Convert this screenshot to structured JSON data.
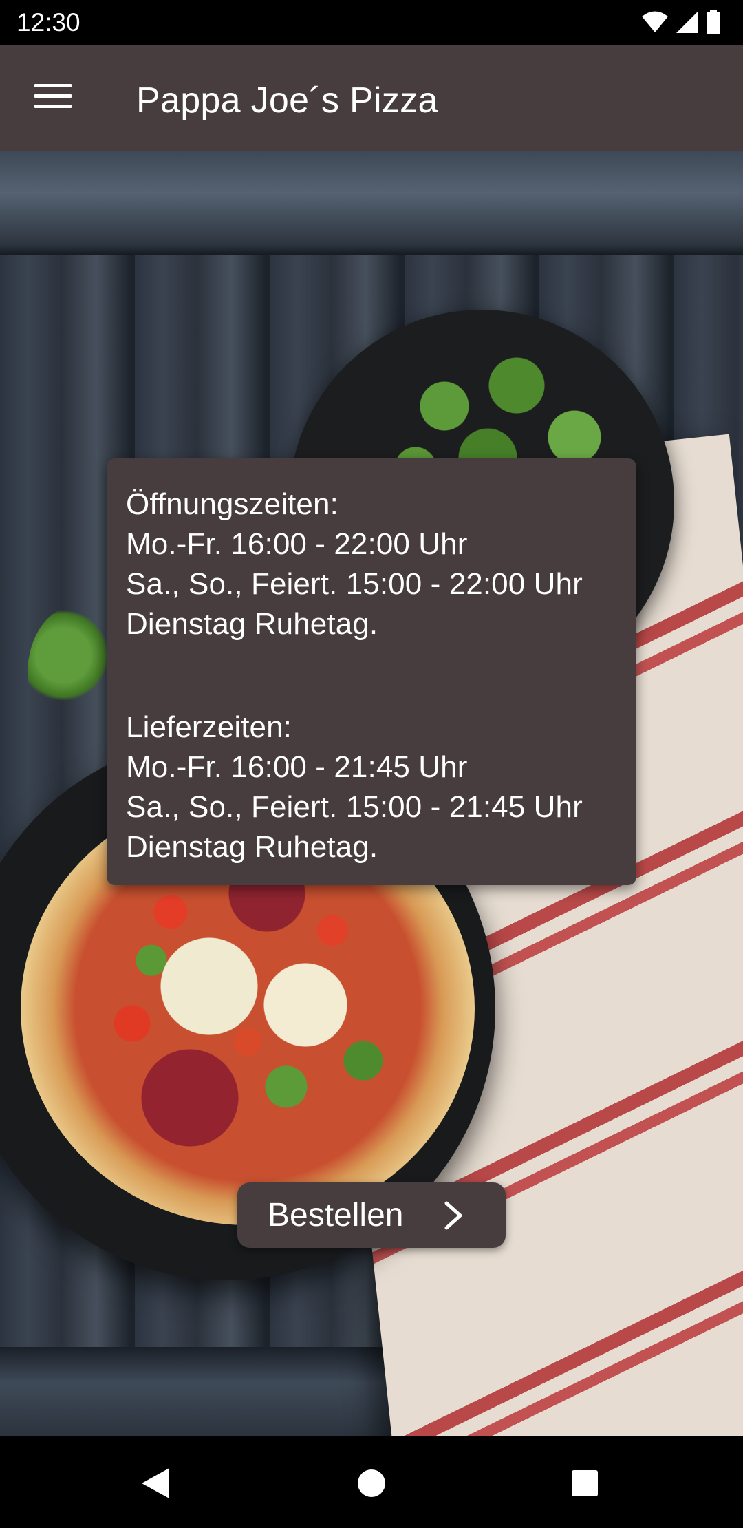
{
  "status_bar": {
    "time": "12:30",
    "icons": [
      "wifi-icon",
      "cellular-signal-icon",
      "battery-icon"
    ]
  },
  "app_bar": {
    "title": "Pappa Joe´s Pizza",
    "menu_icon": "hamburger-menu-icon"
  },
  "info_card": {
    "opening_heading": "Öffnungszeiten:",
    "opening_weekdays": "Mo.-Fr. 16:00 - 22:00 Uhr",
    "opening_weekend": "Sa., So., Feiert. 15:00 - 22:00 Uhr",
    "opening_closed": "Dienstag Ruhetag.",
    "delivery_heading": "Lieferzeiten:",
    "delivery_weekdays": "Mo.-Fr. 16:00 - 21:45 Uhr",
    "delivery_weekend": "Sa., So., Feiert. 15:00 - 21:45 Uhr",
    "delivery_closed": "Dienstag Ruhetag."
  },
  "order_button": {
    "label": "Bestellen",
    "icon": "chevron-right-icon"
  },
  "nav_bar": {
    "buttons": [
      "back-triangle-icon",
      "home-circle-icon",
      "recents-square-icon"
    ]
  },
  "colors": {
    "app_bar": "#473d3e",
    "card": "#473d3e",
    "text": "#ffffff",
    "system_bars": "#000000"
  }
}
